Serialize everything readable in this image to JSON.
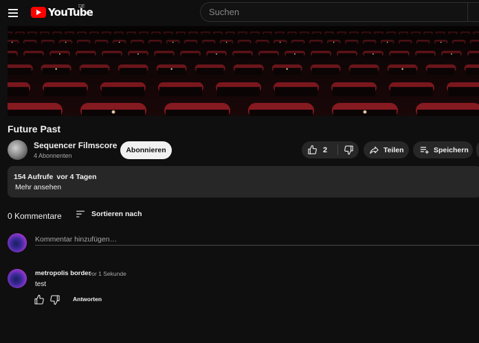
{
  "header": {
    "logo_text": "YouTube",
    "region": "DE",
    "search_placeholder": "Suchen"
  },
  "video": {
    "title": "Future Past"
  },
  "channel": {
    "name": "Sequencer Filmscore",
    "subscribers": "4 Abonnenten",
    "subscribe_label": "Abonnieren"
  },
  "actions": {
    "like_count": "2",
    "share_label": "Teilen",
    "save_label": "Speichern"
  },
  "description": {
    "views": "154 Aufrufe",
    "date": "vor 4 Tagen",
    "more_label": "Mehr ansehen"
  },
  "comments": {
    "count_label": "0 Kommentare",
    "sort_label": "Sortieren nach",
    "add_placeholder": "Kommentar hinzufügen…",
    "items": [
      {
        "author": "metropolis border",
        "time": "vor 1 Sekunde",
        "text": "test",
        "reply_label": "Antworten"
      }
    ]
  },
  "colors": {
    "background": "#0f0f0f",
    "surface": "#272727",
    "brand_red": "#ff0000",
    "text_primary": "#f1f1f1",
    "text_secondary": "#aaaaaa",
    "subscribe_bg": "#f1f1f1"
  },
  "icons": [
    "menu-icon",
    "youtube-logo-icon",
    "like-icon",
    "dislike-icon",
    "share-icon",
    "save-playlist-icon",
    "sort-icon"
  ]
}
